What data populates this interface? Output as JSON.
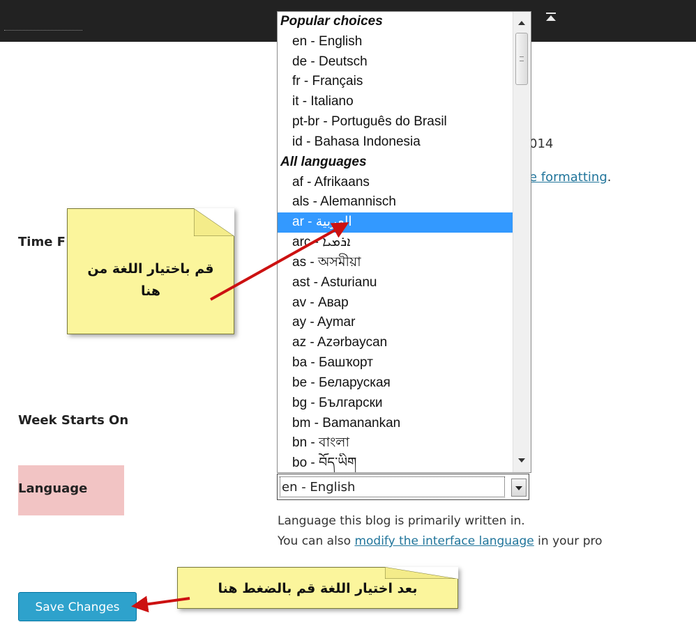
{
  "labels": {
    "time_format": "Time F",
    "week_starts_on": "Week Starts On",
    "language": "Language"
  },
  "partial_text": {
    "date_year": "014",
    "formatting_link": "e formatting",
    "formatting_period": "."
  },
  "language_select": {
    "selected_value": "en - English",
    "description_line1": "Language this blog is primarily written in.",
    "description_line2_prefix": "You can also ",
    "description_line2_link": "modify the interface language",
    "description_line2_suffix": " in your pro"
  },
  "dropdown": {
    "rows": [
      {
        "type": "group",
        "text": "Popular choices"
      },
      {
        "type": "option",
        "text": "en - English"
      },
      {
        "type": "option",
        "text": "de - Deutsch"
      },
      {
        "type": "option",
        "text": "fr - Français"
      },
      {
        "type": "option",
        "text": "it - Italiano"
      },
      {
        "type": "option",
        "text": "pt-br - Português do Brasil"
      },
      {
        "type": "option",
        "text": "id - Bahasa Indonesia"
      },
      {
        "type": "group",
        "text": "All languages"
      },
      {
        "type": "option",
        "text": "af - Afrikaans"
      },
      {
        "type": "option",
        "text": "als - Alemannisch"
      },
      {
        "type": "option",
        "text": "ar - العربية",
        "selected": true
      },
      {
        "type": "option",
        "text": "arc - ܐܪܡܝܐ"
      },
      {
        "type": "option",
        "text": "as - অসমীয়া"
      },
      {
        "type": "option",
        "text": "ast - Asturianu"
      },
      {
        "type": "option",
        "text": "av - Авар"
      },
      {
        "type": "option",
        "text": "ay - Aymar"
      },
      {
        "type": "option",
        "text": "az - Azərbaycan"
      },
      {
        "type": "option",
        "text": "ba - Башҡорт"
      },
      {
        "type": "option",
        "text": "be - Беларуская"
      },
      {
        "type": "option",
        "text": "bg - Български"
      },
      {
        "type": "option",
        "text": "bm - Bamanankan"
      },
      {
        "type": "option",
        "text": "bn - বাংলা"
      },
      {
        "type": "option",
        "text": "bo - བོད་ཡིག"
      }
    ]
  },
  "save_button": {
    "label": "Save Changes"
  },
  "annotations": {
    "note_select_line1": "قم باختيار اللغة من",
    "note_select_line2": "هنا",
    "note_save": "بعد اختيار اللغة قم بالضغط هنا"
  },
  "colors": {
    "topbar": "#222222",
    "selected_option": "#3399ff",
    "save_button": "#2ea2cc",
    "language_highlight": "#f2c4c4",
    "sticky_note": "#fbf59c",
    "arrow": "#cc1111"
  },
  "icons": {
    "collapse": "collapse-up-icon",
    "dropdown_arrow": "chevron-down-icon"
  }
}
